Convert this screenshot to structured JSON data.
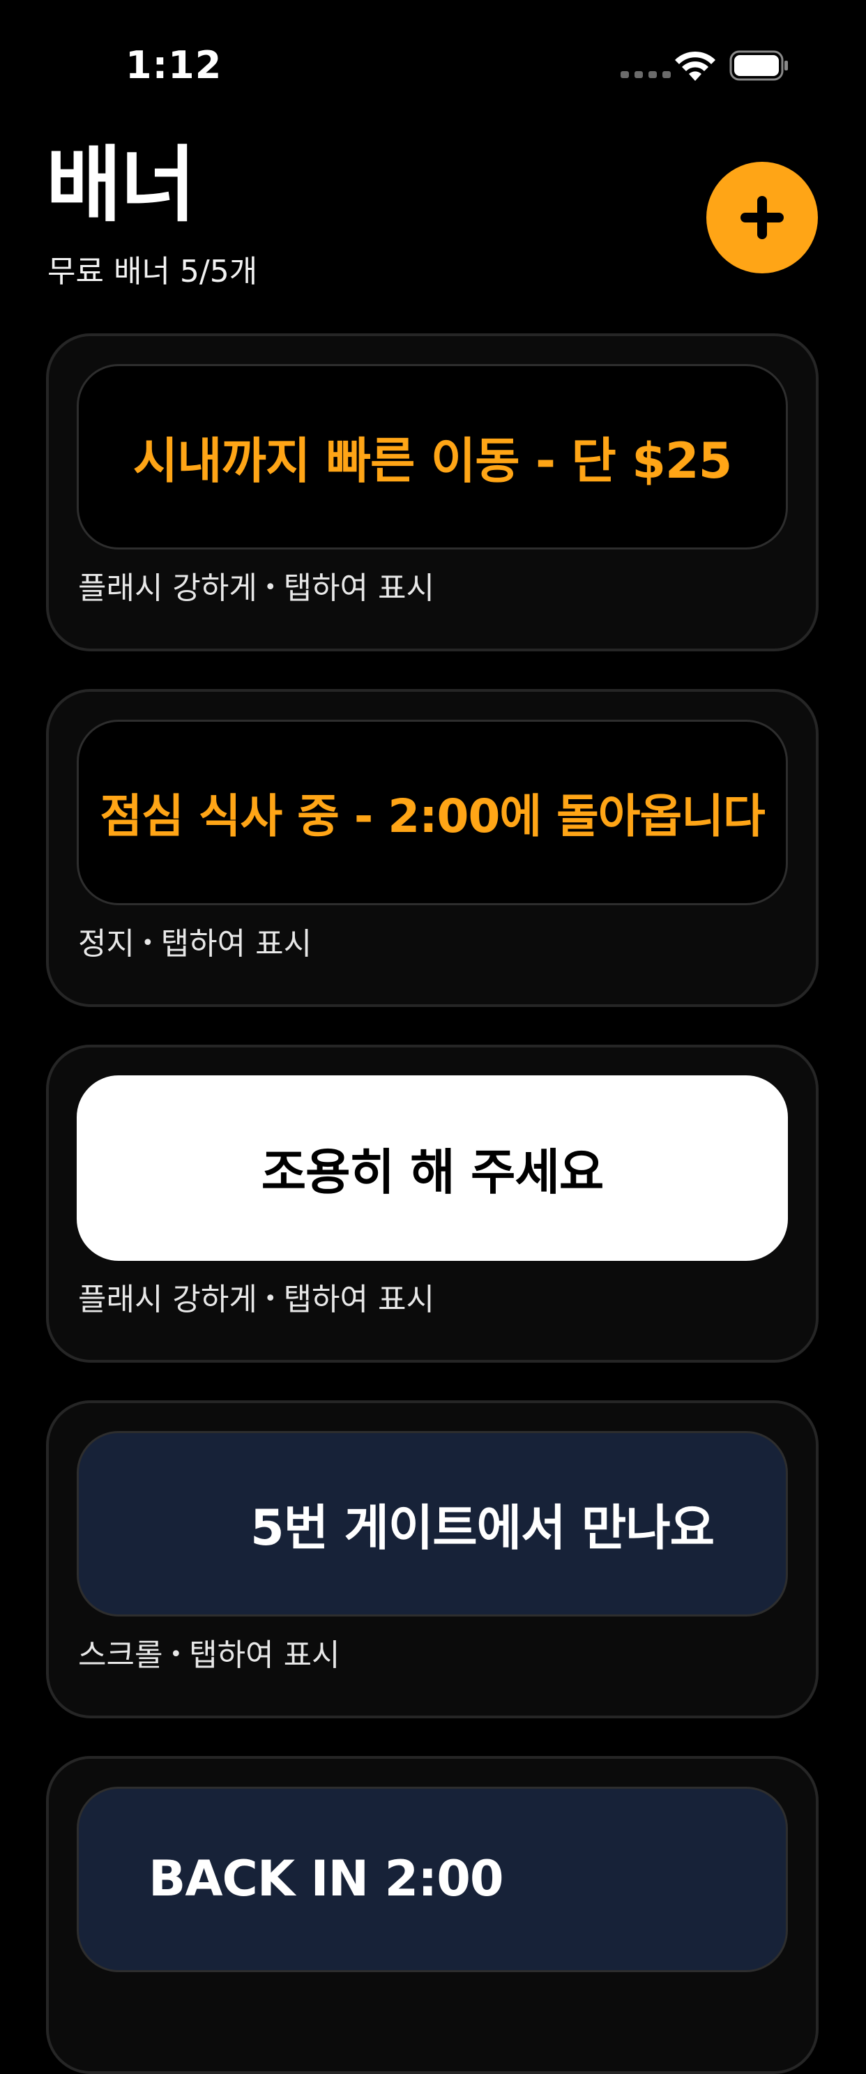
{
  "status_bar": {
    "time": "1:12"
  },
  "header": {
    "title": "배너",
    "subtitle": "무료 배너 5/5개",
    "add_icon": "plus-icon"
  },
  "colors": {
    "accent": "#FFA516",
    "background": "#000000",
    "card": "#0B0B0B",
    "navy": "#172238"
  },
  "cards": [
    {
      "banner_text": "시내까지 빠른 이동 - 단 $25",
      "banner_bg": "#000000",
      "banner_fg": "#FFA516",
      "effect": "플래시 강하게",
      "action": "탭하여 표시"
    },
    {
      "banner_text": "점심 식사 중 - 2:00에 돌아옵니다",
      "banner_bg": "#000000",
      "banner_fg": "#FFA516",
      "effect": "정지",
      "action": "탭하여 표시"
    },
    {
      "banner_text": "조용히 해 주세요",
      "banner_bg": "#FFFFFF",
      "banner_fg": "#000000",
      "effect": "플래시 강하게",
      "action": "탭하여 표시"
    },
    {
      "banner_text": "5번 게이트에서 만나요",
      "banner_bg": "#172238",
      "banner_fg": "#FFFFFF",
      "effect": "스크롤",
      "action": "탭하여 표시"
    },
    {
      "banner_text": "BACK IN 2:00",
      "banner_bg": "#172238",
      "banner_fg": "#FFFFFF",
      "effect": "",
      "action": ""
    }
  ]
}
